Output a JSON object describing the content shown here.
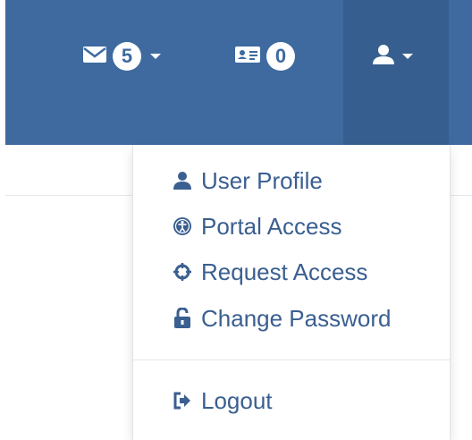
{
  "navbar": {
    "messages": {
      "icon": "envelope-icon",
      "count": "5"
    },
    "cards": {
      "icon": "id-card-icon",
      "count": "0"
    },
    "user": {
      "icon": "user-icon"
    }
  },
  "dropdown": {
    "items": [
      {
        "label": "User Profile",
        "icon": "user-icon"
      },
      {
        "label": "Portal Access",
        "icon": "accessibility-icon"
      },
      {
        "label": "Request Access",
        "icon": "crosshair-icon"
      },
      {
        "label": "Change Password",
        "icon": "unlock-icon"
      }
    ],
    "logout": {
      "label": "Logout",
      "icon": "sign-out-icon"
    }
  },
  "colors": {
    "navbar": "#3e6a9f",
    "navbar_active": "#365f8f",
    "link": "#3a5f90"
  }
}
